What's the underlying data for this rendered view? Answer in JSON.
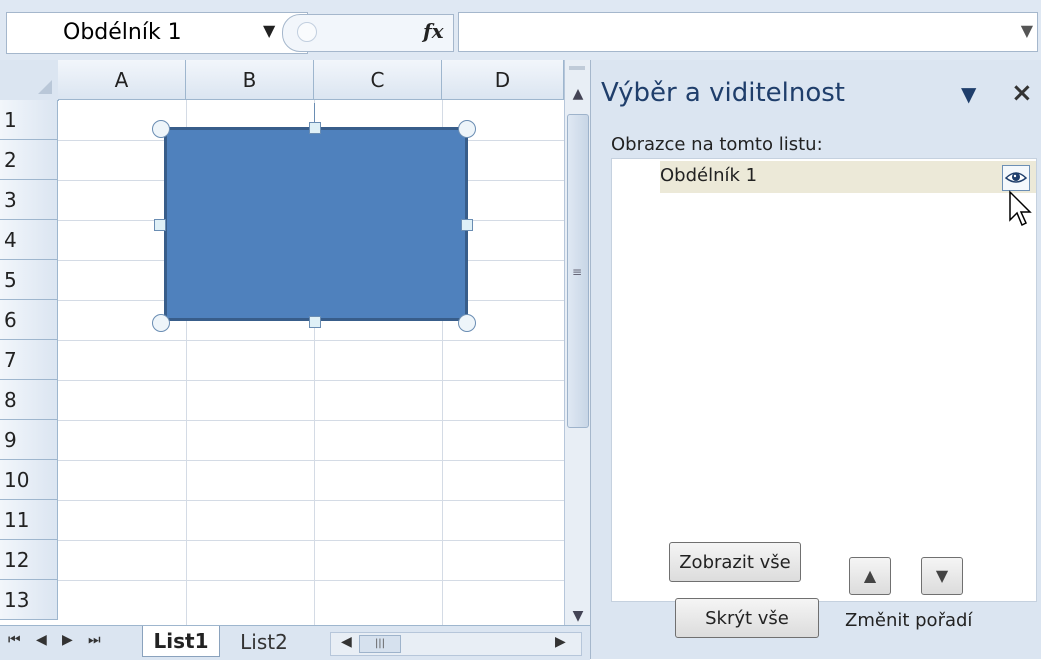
{
  "formula_bar": {
    "name_box": "Obdélník 1",
    "fx_label": "fx",
    "formula_value": ""
  },
  "sheet": {
    "columns": [
      "A",
      "B",
      "C",
      "D"
    ],
    "rows": [
      "1",
      "2",
      "3",
      "4",
      "5",
      "6",
      "7",
      "8",
      "9",
      "10",
      "11",
      "12",
      "13"
    ],
    "shape_color": "#4f81bd",
    "shape_border": "#385d8a"
  },
  "sheet_tabs": {
    "tabs": [
      "List1",
      "List2"
    ],
    "active": "List1"
  },
  "selection_pane": {
    "title": "Výběr a viditelnost",
    "close_glyph": "×",
    "menu_glyph": "▼",
    "subtitle": "Obrazce na tomto listu:",
    "items": [
      {
        "label": "Obdélník 1",
        "visible": true,
        "selected": true
      }
    ],
    "show_all_label": "Zobrazit vše",
    "hide_all_label": "Skrýt vše",
    "reorder_label": "Změnit pořadí"
  }
}
